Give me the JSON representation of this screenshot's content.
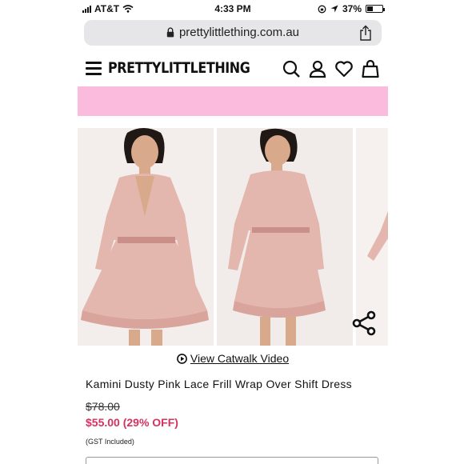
{
  "status": {
    "carrier": "AT&T",
    "time": "4:33 PM",
    "battery": "37%",
    "battery_level": 0.37
  },
  "browser": {
    "url": "prettylittlething.com.au"
  },
  "header": {
    "logo": "PRETTYLITTLETHING",
    "icons": [
      "menu-icon",
      "search-icon",
      "account-icon",
      "wishlist-heart-icon",
      "bag-icon"
    ]
  },
  "colors": {
    "banner": "#fbbbdc",
    "sale_price": "#d6325f",
    "dress": "#e3b6ae"
  },
  "product": {
    "catwalk_link": "View Catwalk Video",
    "title": "Kamini Dusty Pink Lace Frill Wrap Over Shift Dress",
    "old_price": "$78.00",
    "new_price": "$55.00 (29% OFF)",
    "gst_note": "(GST Included)"
  }
}
